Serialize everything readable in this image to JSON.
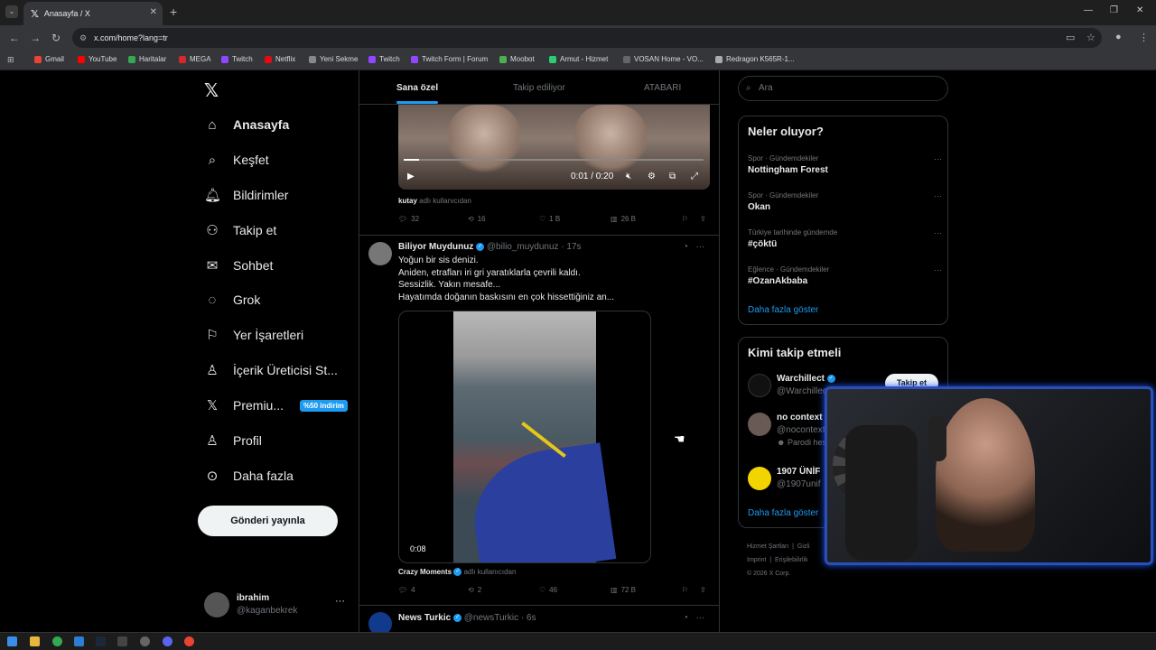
{
  "browser": {
    "tab_title": "Anasayfa / X",
    "url": "x.com/home?lang=tr",
    "bookmarks": [
      "Gmail",
      "YouTube",
      "Haritalar",
      "MEGA",
      "Twitch",
      "Netflix",
      "Yeni Sekme",
      "Twitch",
      "Twitch Form | Forum",
      "Moobot",
      "Armut - Hizmet",
      "VOSAN Home - VO...",
      "Redragon K565R-1..."
    ]
  },
  "sidebar": {
    "items": [
      {
        "label": "Anasayfa",
        "icon": "home-icon"
      },
      {
        "label": "Keşfet",
        "icon": "search-icon"
      },
      {
        "label": "Bildirimler",
        "icon": "bell-icon"
      },
      {
        "label": "Takip et",
        "icon": "add-person-icon"
      },
      {
        "label": "Sohbet",
        "icon": "mail-icon"
      },
      {
        "label": "Grok",
        "icon": "grok-icon"
      },
      {
        "label": "Yer İşaretleri",
        "icon": "bookmark-icon"
      },
      {
        "label": "İçerik Üreticisi St...",
        "icon": "creator-icon"
      },
      {
        "label": "Premiu...",
        "icon": "x-icon"
      },
      {
        "label": "Profil",
        "icon": "person-icon"
      },
      {
        "label": "Daha fazla",
        "icon": "more-circle-icon"
      }
    ],
    "premium_badge": "%50 indirim",
    "post_button": "Gönderi yayınla",
    "user_name": "ibrahim",
    "user_handle": "@kaganbekrek"
  },
  "feed": {
    "tabs": [
      "Sana özel",
      "Takip ediliyor",
      "ATABARI"
    ],
    "video1": {
      "time": "0:01 / 0:20",
      "progress": 0.05,
      "tag_user": "kutay",
      "tag_suffix": "adlı kullanıcıdan",
      "replies": "32",
      "reposts": "16",
      "likes": "1 B",
      "views": "26 B"
    },
    "tweet2": {
      "name": "Biliyor Muydunuz",
      "handle": "@bilio_muydunuz",
      "time": "· 17s",
      "lines": [
        "Yoğun bir sis denizi.",
        "Aniden, etrafları iri gri yaratıklarla çevrili kaldı.",
        "Sessizlik. Yakın mesafe...",
        "Hayatımda doğanın baskısını en çok hissettiğiniz an..."
      ],
      "video_time": "0:08",
      "tag_user": "Crazy Moments",
      "tag_suffix": "adlı kullanıcıdan",
      "replies": "4",
      "reposts": "2",
      "likes": "46",
      "views": "72 B"
    },
    "tweet3": {
      "name": "News Turkic",
      "handle": "@newsTurkic",
      "time": "· 6s"
    }
  },
  "right": {
    "search_placeholder": "Ara",
    "trends_title": "Neler oluyor?",
    "trends": [
      {
        "meta": "Spor · Gündemdekiler",
        "name": "Nottingham Forest"
      },
      {
        "meta": "Spor · Gündemdekiler",
        "name": "Okan"
      },
      {
        "meta": "Türkiye tarihinde gündemde",
        "name": "#çöktü"
      },
      {
        "meta": "Eğlence · Gündemdekiler",
        "name": "#OzanAkbaba"
      }
    ],
    "show_more": "Daha fazla göster",
    "follow_title": "Kimi takip etmeli",
    "follow": [
      {
        "name": "Warchillect",
        "handle": "@Warchillect",
        "note": ""
      },
      {
        "name": "no context kurtlar ...",
        "handle": "@nocontexttkv",
        "note": "Parodi hesabı"
      },
      {
        "name": "1907 ÜNİF",
        "handle": "@1907unif",
        "note": ""
      }
    ],
    "follow_button": "Takip et",
    "footer": [
      "Hizmet Şartları",
      "Gizli",
      "Imprint",
      "Erişilebilirlik",
      "© 2026 X Corp."
    ]
  }
}
